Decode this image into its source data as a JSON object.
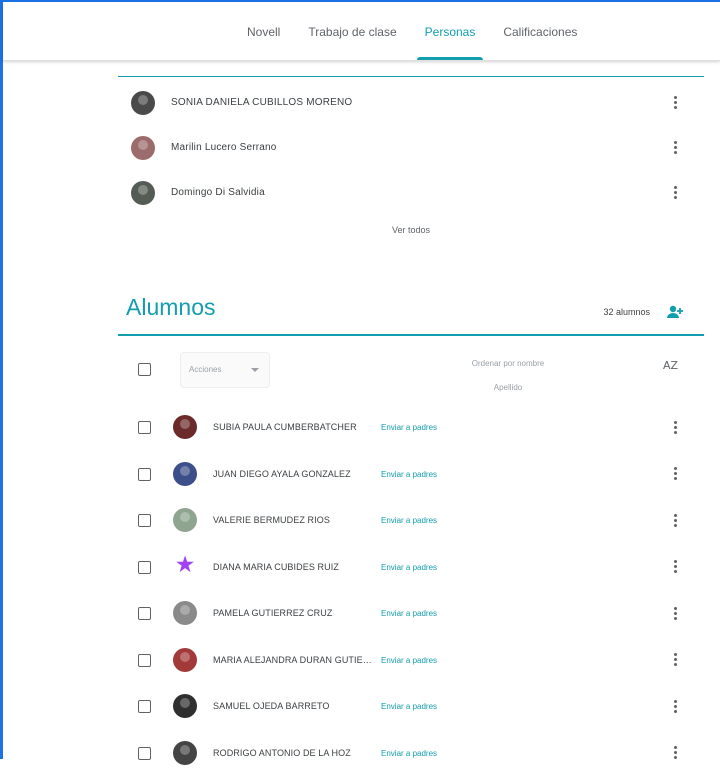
{
  "nav": {
    "tabs": [
      {
        "label": "Novell",
        "active": false
      },
      {
        "label": "Trabajo de clase",
        "active": false
      },
      {
        "label": "Personas",
        "active": true
      },
      {
        "label": "Calificaciones",
        "active": false
      }
    ]
  },
  "teachers": {
    "items": [
      {
        "name": "SONIA DANIELA CUBILLOS MORENO",
        "avatar_color": "#4a4a4a"
      },
      {
        "name": "Marilin Lucero Serrano",
        "avatar_color": "#9c6b6b"
      },
      {
        "name": "Domingo Di Salvidia",
        "avatar_color": "#555c55"
      }
    ],
    "see_all": "Ver todos"
  },
  "students": {
    "title": "Alumnos",
    "count_label": "32 alumnos",
    "actions_placeholder": "Acciones",
    "sort_label": "Ordenar por nombre",
    "sort_label_line2": "Apellido",
    "sort_icon": "AZ",
    "email_label": "Enviar a padres",
    "items": [
      {
        "name": "SUBIA PAULA CUMBERBATCHER",
        "avatar_type": "photo",
        "avatar_color": "#6b2b2b"
      },
      {
        "name": "JUAN DIEGO AYALA GONZALEZ",
        "avatar_type": "photo",
        "avatar_color": "#3d4f8a"
      },
      {
        "name": "VALERIE BERMUDEZ RIOS",
        "avatar_type": "photo",
        "avatar_color": "#8fa58f"
      },
      {
        "name": "DIANA MARIA CUBIDES RUIZ",
        "avatar_type": "star",
        "avatar_color": "#a142f4"
      },
      {
        "name": "PAMELA GUTIERREZ CRUZ",
        "avatar_type": "photo",
        "avatar_color": "#8a8a8a"
      },
      {
        "name": "MARIA ALEJANDRA DURAN GUTIERREZ",
        "avatar_type": "photo",
        "avatar_color": "#a33a3a"
      },
      {
        "name": "SAMUEL OJEDA BARRETO",
        "avatar_type": "photo",
        "avatar_color": "#2f2f2f"
      },
      {
        "name": "RODRIGO ANTONIO DE LA HOZ",
        "avatar_type": "photo",
        "avatar_color": "#444444"
      }
    ]
  },
  "colors": {
    "accent": "#129eaf",
    "frame": "#1a73e8"
  }
}
